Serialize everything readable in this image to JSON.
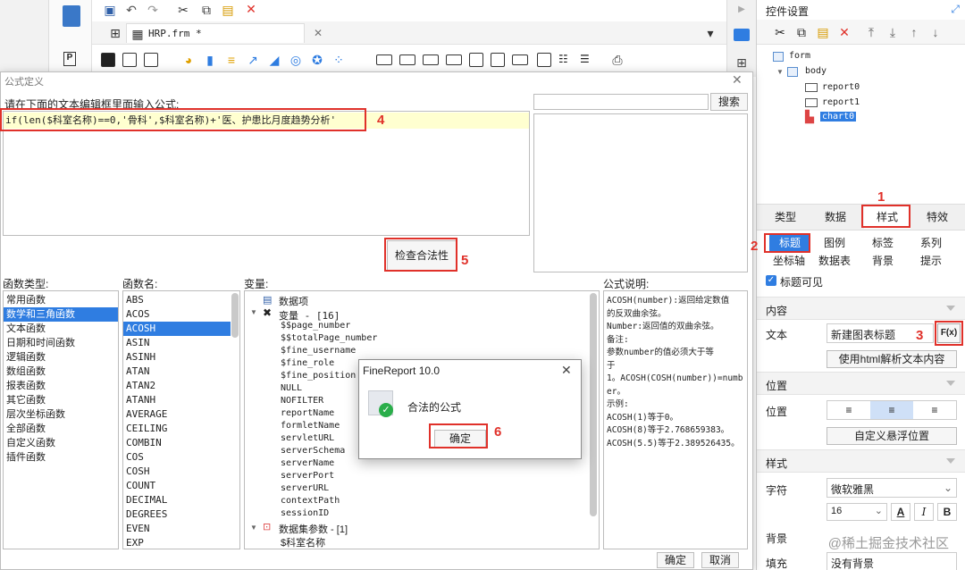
{
  "app": {
    "tab_file": "HRP.frm *"
  },
  "right_panel": {
    "title": "控件设置",
    "tree": {
      "form": "form",
      "body": "body",
      "report0": "report0",
      "report1": "report1",
      "chart0": "chart0"
    },
    "main_tabs": [
      "类型",
      "数据",
      "样式",
      "特效"
    ],
    "sub_tabs_row1": [
      "标题",
      "图例",
      "标签",
      "系列"
    ],
    "sub_tabs_row2": [
      "坐标轴",
      "数据表",
      "背景",
      "提示"
    ],
    "title_visible": "标题可见",
    "section_content": "内容",
    "text_label": "文本",
    "text_value": "新建图表标题",
    "fx_label": "F(x)",
    "html_button": "使用html解析文本内容",
    "section_position": "位置",
    "position_label": "位置",
    "custom_position_button": "自定义悬浮位置",
    "section_style": "样式",
    "font_label": "字符",
    "font_value": "微软雅黑",
    "font_size": "16",
    "bold": "A",
    "italic": "I",
    "bold2": "B",
    "bg_label": "背景",
    "fill_label": "填充",
    "fill_value": "没有背景"
  },
  "dialog": {
    "title": "公式定义",
    "prompt": "请在下面的文本编辑框里面输入公式:",
    "search_button": "搜索",
    "formula": "if(len($科室名称)==0,'骨科',$科室名称)+'医、护患比月度趋势分析'",
    "check_button": "检查合法性",
    "func_type_label": "函数类型:",
    "func_types": [
      "常用函数",
      "数学和三角函数",
      "文本函数",
      "日期和时间函数",
      "逻辑函数",
      "数组函数",
      "报表函数",
      "其它函数",
      "层次坐标函数",
      "全部函数",
      "自定义函数",
      "插件函数"
    ],
    "func_name_label": "函数名:",
    "func_names": [
      "ABS",
      "ACOS",
      "ACOSH",
      "ASIN",
      "ASINH",
      "ATAN",
      "ATAN2",
      "ATANH",
      "AVERAGE",
      "CEILING",
      "COMBIN",
      "COS",
      "COSH",
      "COUNT",
      "DECIMAL",
      "DEGREES",
      "EVEN",
      "EXP"
    ],
    "var_label": "变量:",
    "var_root": "数据项",
    "var_group": "变量 - [16]",
    "vars": [
      "$$page_number",
      "$$totalPage_number",
      "$fine_username",
      "$fine_role",
      "$fine_position",
      "NULL",
      "NOFILTER",
      "reportName",
      "formletName",
      "servletURL",
      "serverSchema",
      "serverName",
      "serverPort",
      "serverURL",
      "contextPath",
      "sessionID"
    ],
    "dataset_group": "数据集参数 - [1]",
    "dataset_param": "$科室名称",
    "desc_label": "公式说明:",
    "desc_lines": [
      "ACOSH(number):返回给定数值",
      "的反双曲余弦。",
      "Number:返回值的双曲余弦。",
      "备注:",
      "参数number的值必须大于等",
      "于",
      "1。ACOSH(COSH(number))=numb",
      "er。",
      "示例:",
      "ACOSH(1)等于0。",
      "ACOSH(8)等于2.768659383。",
      "ACOSH(5.5)等于2.389526435。"
    ],
    "ok_button": "确定",
    "cancel_button": "取消"
  },
  "popup": {
    "title": "FineReport 10.0",
    "message": "合法的公式",
    "ok": "确定"
  },
  "annotations": [
    "1",
    "2",
    "3",
    "4",
    "5",
    "6"
  ],
  "watermark": "@稀土掘金技术社区",
  "colors": {
    "accent": "#2f7de1",
    "highlight": "#e0312a",
    "formula_bg": "#ffffd0",
    "success": "#2aae4a"
  }
}
